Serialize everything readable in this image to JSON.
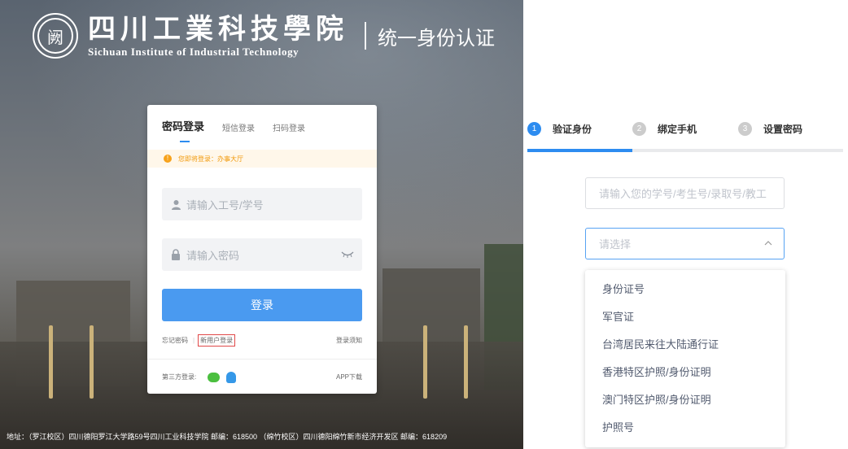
{
  "brand": {
    "seal_glyph": "阙",
    "name_cn": "四川工業科技學院",
    "name_en": "Sichuan Institute of Industrial Technology",
    "system": "统一身份认证"
  },
  "login": {
    "tabs": [
      "密码登录",
      "短信登录",
      "扫码登录"
    ],
    "notice_icon": "!",
    "notice": "您即将登录：办事大厅",
    "username_placeholder": "请输入工号/学号",
    "password_placeholder": "请输入密码",
    "submit": "登录",
    "forgot": "忘记密码",
    "separator": "|",
    "new_user": "新用户登录",
    "help": "登录须知",
    "third_party_label": "第三方登录:",
    "app_download": "APP下载"
  },
  "footer": "地址：（罗江校区）四川德阳罗江大学路59号四川工业科技学院 邮编：618500 （绵竹校区）四川德阳绵竹新市经济开发区 邮编：618209",
  "steps": [
    {
      "num": "1",
      "label": "验证身份"
    },
    {
      "num": "2",
      "label": "绑定手机"
    },
    {
      "num": "3",
      "label": "设置密码"
    }
  ],
  "verify": {
    "id_placeholder": "请输入您的学号/考生号/录取号/教工",
    "select_placeholder": "请选择",
    "options": [
      "身份证号",
      "军官证",
      "台湾居民来往大陆通行证",
      "香港特区护照/身份证明",
      "澳门特区护照/身份证明",
      "护照号"
    ]
  },
  "colors": {
    "accent": "#2d8cf0",
    "button": "#4a9af0",
    "warning": "#f7a21b",
    "wechat": "#4bbf3f",
    "qq": "#3598e8"
  }
}
